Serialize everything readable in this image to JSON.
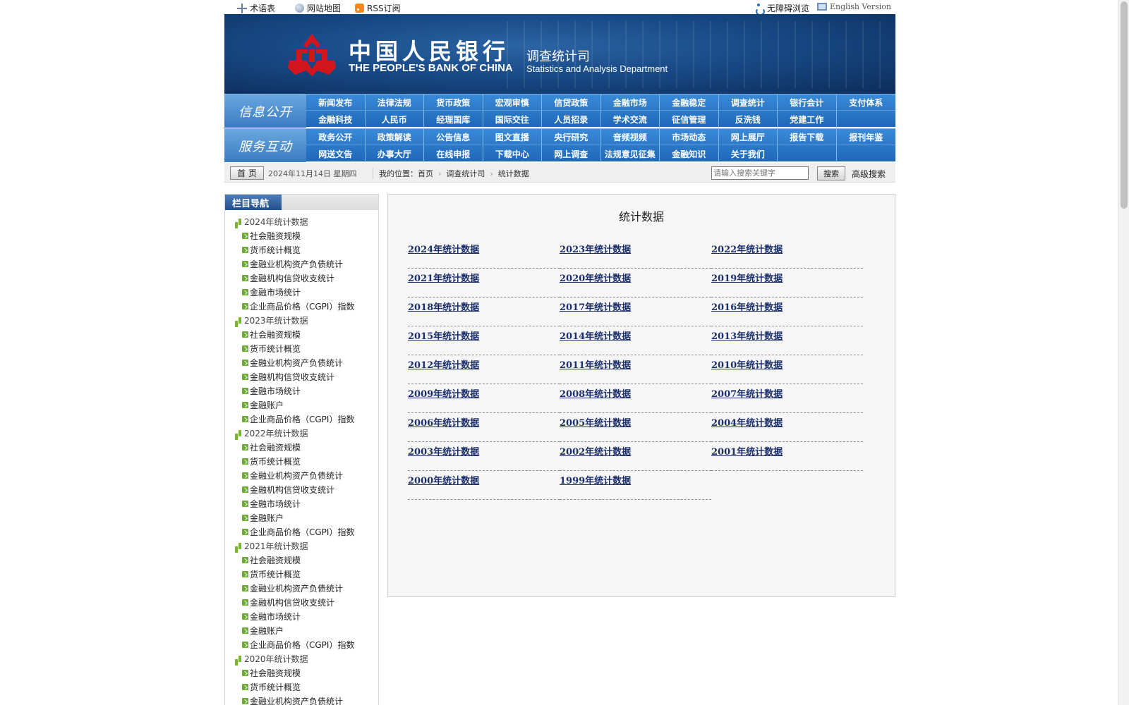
{
  "topbar": {
    "glossary": "术语表",
    "sitemap": "网站地图",
    "rss": "RSS订阅",
    "accessible": "无障碍浏览",
    "english": "English Version"
  },
  "banner": {
    "bank_cn": "中国人民银行",
    "bank_en": "THE PEOPLE'S BANK OF CHINA",
    "dept_cn": "调查统计司",
    "dept_en": "Statistics and Analysis Department"
  },
  "nav": {
    "info_label": "信息公开",
    "info_items": [
      "新闻发布",
      "法律法规",
      "货币政策",
      "宏观审慎",
      "信贷政策",
      "金融市场",
      "金融稳定",
      "调查统计",
      "银行会计",
      "支付体系",
      "金融科技",
      "人民币",
      "经理国库",
      "国际交往",
      "人员招录",
      "学术交流",
      "征信管理",
      "反洗钱",
      "党建工作",
      ""
    ],
    "service_label": "服务互动",
    "service_items": [
      "政务公开",
      "政策解读",
      "公告信息",
      "图文直播",
      "央行研究",
      "音频视频",
      "市场动态",
      "网上展厅",
      "报告下载",
      "报刊年鉴",
      "网送文告",
      "办事大厅",
      "在线申报",
      "下载中心",
      "网上调查",
      "法规意见征集",
      "金融知识",
      "关于我们",
      "",
      ""
    ]
  },
  "crumbbar": {
    "home": "首 页",
    "date": "2024年11月14日  星期四",
    "location_label": "我的位置：",
    "crumb1": "首页",
    "crumb2": "调查统计司",
    "crumb3": "统计数据",
    "search_placeholder": "请输入搜索关键字",
    "search_button": "搜索",
    "advanced": "高级搜索"
  },
  "sidebar": {
    "title": "栏目导航",
    "tree": [
      {
        "year": "2024年统计数据",
        "items": [
          "社会融资规模",
          "货币统计概览",
          "金融业机构资产负债统计",
          "金融机构信贷收支统计",
          "金融市场统计",
          "企业商品价格（CGPI）指数"
        ]
      },
      {
        "year": "2023年统计数据",
        "items": [
          "社会融资规模",
          "货币统计概览",
          "金融业机构资产负债统计",
          "金融机构信贷收支统计",
          "金融市场统计",
          "金融账户",
          "企业商品价格（CGPI）指数"
        ]
      },
      {
        "year": "2022年统计数据",
        "items": [
          "社会融资规模",
          "货币统计概览",
          "金融业机构资产负债统计",
          "金融机构信贷收支统计",
          "金融市场统计",
          "金融账户",
          "企业商品价格（CGPI）指数"
        ]
      },
      {
        "year": "2021年统计数据",
        "items": [
          "社会融资规模",
          "货币统计概览",
          "金融业机构资产负债统计",
          "金融机构信贷收支统计",
          "金融市场统计",
          "金融账户",
          "企业商品价格（CGPI）指数"
        ]
      },
      {
        "year": "2020年统计数据",
        "items": [
          "社会融资规模",
          "货币统计概览",
          "金融业机构资产负债统计"
        ]
      }
    ]
  },
  "main": {
    "title": "统计数据",
    "links": [
      "2024年统计数据",
      "2023年统计数据",
      "2022年统计数据",
      "2021年统计数据",
      "2020年统计数据",
      "2019年统计数据",
      "2018年统计数据",
      "2017年统计数据",
      "2016年统计数据",
      "2015年统计数据",
      "2014年统计数据",
      "2013年统计数据",
      "2012年统计数据",
      "2011年统计数据",
      "2010年统计数据",
      "2009年统计数据",
      "2008年统计数据",
      "2007年统计数据",
      "2006年统计数据",
      "2005年统计数据",
      "2004年统计数据",
      "2003年统计数据",
      "2002年统计数据",
      "2001年统计数据",
      "2000年统计数据",
      "1999年统计数据"
    ]
  }
}
